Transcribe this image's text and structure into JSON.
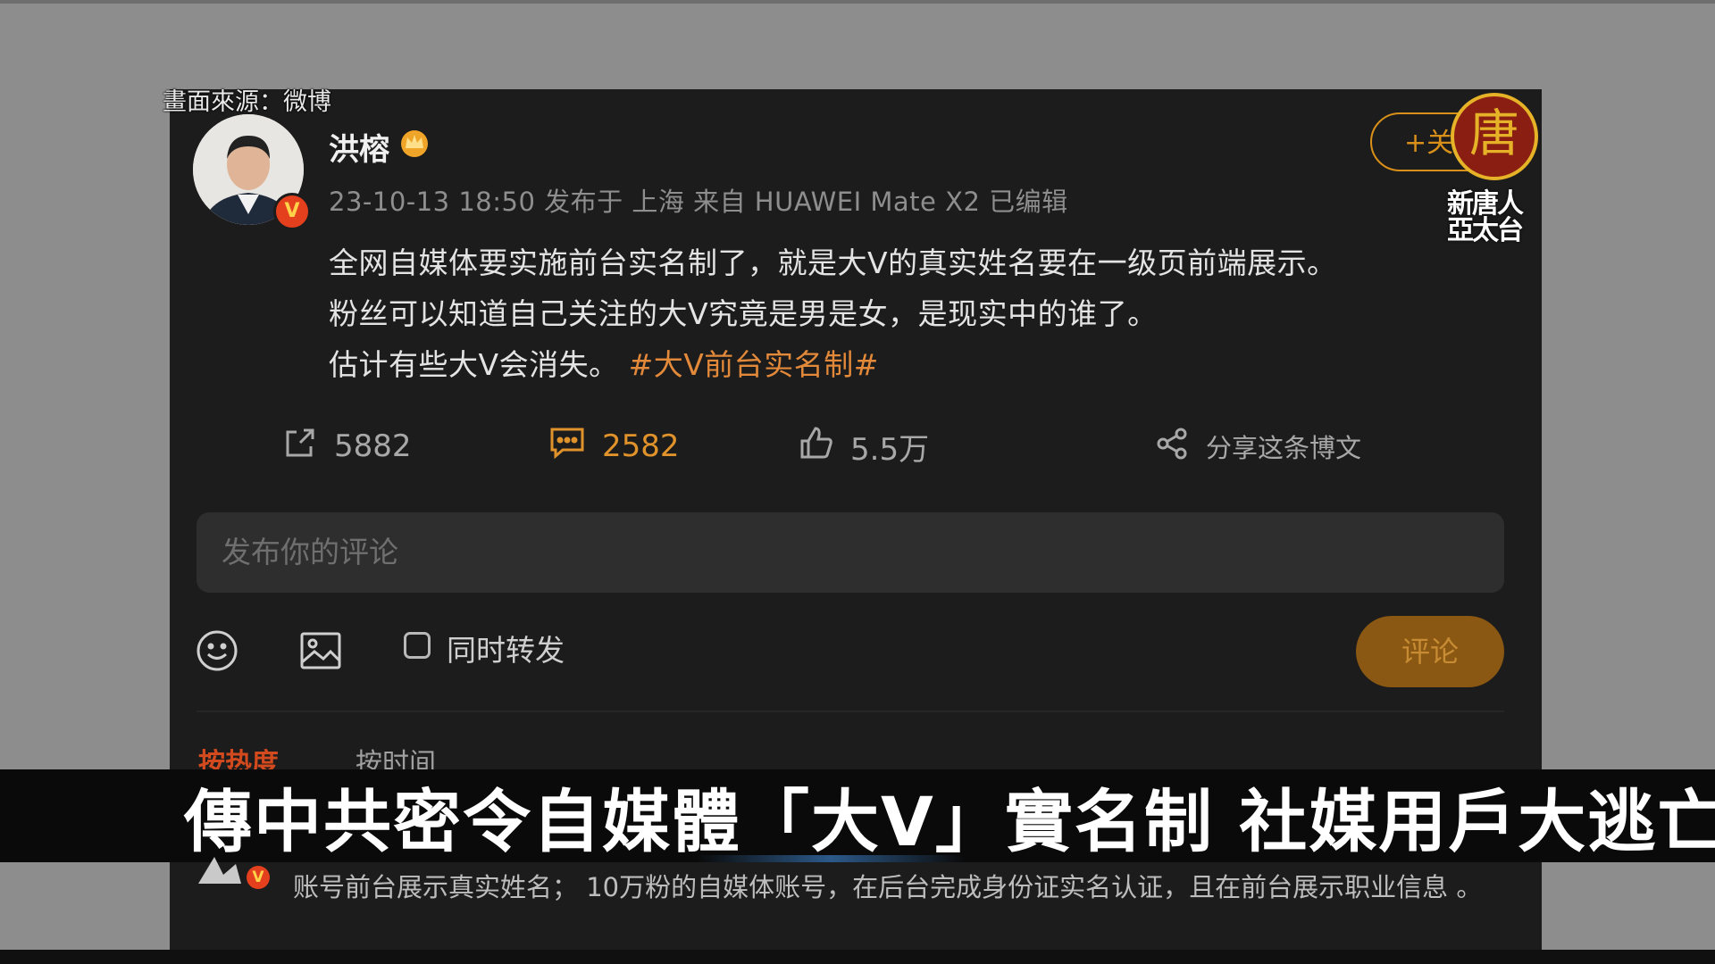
{
  "source_label": "畫面來源：微博",
  "post": {
    "username": "洪榕",
    "meta": "23-10-13 18:50 发布于 上海 来自 HUAWEI Mate X2 已编辑",
    "lines": [
      "全网自媒体要实施前台实名制了，就是大V的真实姓名要在一级页前端展示。",
      "粉丝可以知道自己关注的大V究竟是男是女，是现实中的谁了。",
      "估计有些大V会消失。"
    ],
    "hashtag": "#大V前台实名制#",
    "follow_label": "+关注"
  },
  "actions": {
    "repost_count": "5882",
    "comment_count": "2582",
    "like_count": "5.5万",
    "share_label": "分享这条博文"
  },
  "comment_input": {
    "placeholder": "发布你的评论"
  },
  "composer": {
    "repost_label": "同时转发",
    "submit_label": "评论"
  },
  "sort": {
    "hot": "按热度",
    "time": "按时间"
  },
  "logo": {
    "glyph": "唐",
    "line1": "新唐人",
    "line2": "亞太台"
  },
  "caption": "傳中共密令自媒體「大V」實名制  社媒用戶大逃亡",
  "first_comment": {
    "text": "账号前台展示真实姓名； 10万粉的自媒体账号，在后台完成身份证实名认证，且在前台展示职业信息 。"
  },
  "badge_letter": "V",
  "colors": {
    "accent": "#e0922b",
    "hashtag": "#e2893a",
    "panel": "#1c1c1c"
  },
  "icons": [
    "repost-icon",
    "comment-icon",
    "like-icon",
    "share-icon",
    "emoji-icon",
    "image-icon",
    "crown-icon"
  ]
}
